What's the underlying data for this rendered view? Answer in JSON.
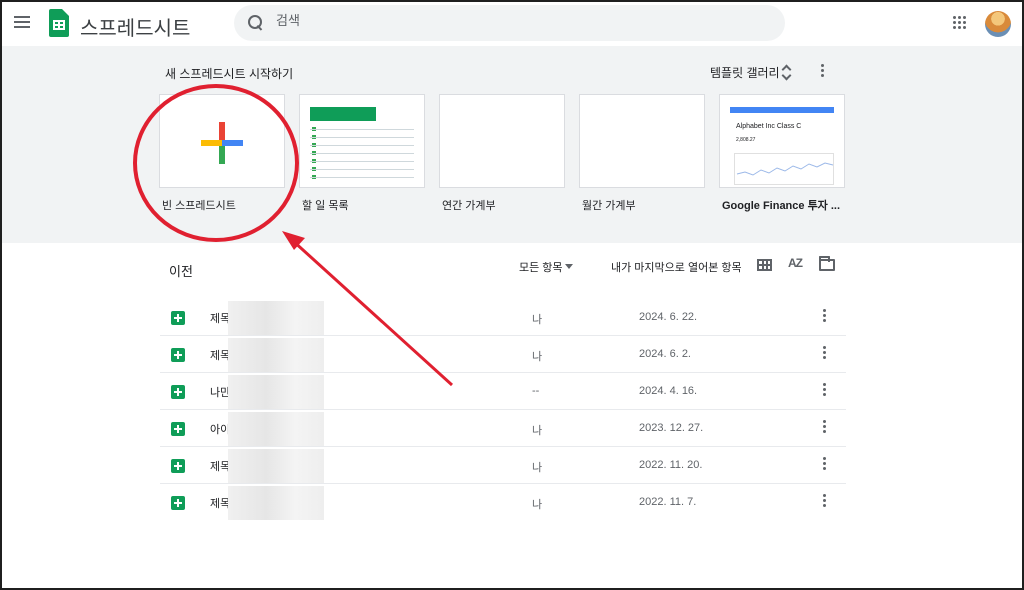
{
  "app": {
    "title": "스프레드시트"
  },
  "search": {
    "placeholder": "검색"
  },
  "templates": {
    "heading": "새 스프레드시트 시작하기",
    "gallery_label": "템플릿 갤러리",
    "items": [
      {
        "label": "빈 스프레드시트"
      },
      {
        "label": "할 일 목록"
      },
      {
        "label": "연간 가계부"
      },
      {
        "label": "월간 가계부"
      },
      {
        "label": "Google Finance 투자 ..."
      }
    ],
    "finance_preview": {
      "title": "Alphabet Inc Class C",
      "value": "2,808.27"
    }
  },
  "recent": {
    "title": "이전",
    "owner_filter": "모든 항목",
    "sort_label": "내가 마지막으로 열어본 항목",
    "sort_icon": "AZ",
    "rows": [
      {
        "name": "제목",
        "owner": "나",
        "date": "2024. 6. 22."
      },
      {
        "name": "제목",
        "owner": "나",
        "date": "2024. 6. 2."
      },
      {
        "name": "나만",
        "owner": "--",
        "date": "2024. 4. 16."
      },
      {
        "name": "아이",
        "owner": "나",
        "date": "2023. 12. 27."
      },
      {
        "name": "제목",
        "owner": "나",
        "date": "2022. 11. 20."
      },
      {
        "name": "제목",
        "owner": "나",
        "date": "2022. 11. 7."
      }
    ]
  },
  "colors": {
    "sheets_green": "#0f9d58",
    "annotation_red": "#e02030",
    "template_bg": "#f1f3f4"
  },
  "icons": [
    "menu-icon",
    "sheets-logo-icon",
    "search-icon",
    "apps-icon",
    "avatar",
    "unfold-icon",
    "more-vert-icon",
    "plus-icon",
    "grid-view-icon",
    "sort-az-icon",
    "folder-icon",
    "sheet-file-icon"
  ]
}
